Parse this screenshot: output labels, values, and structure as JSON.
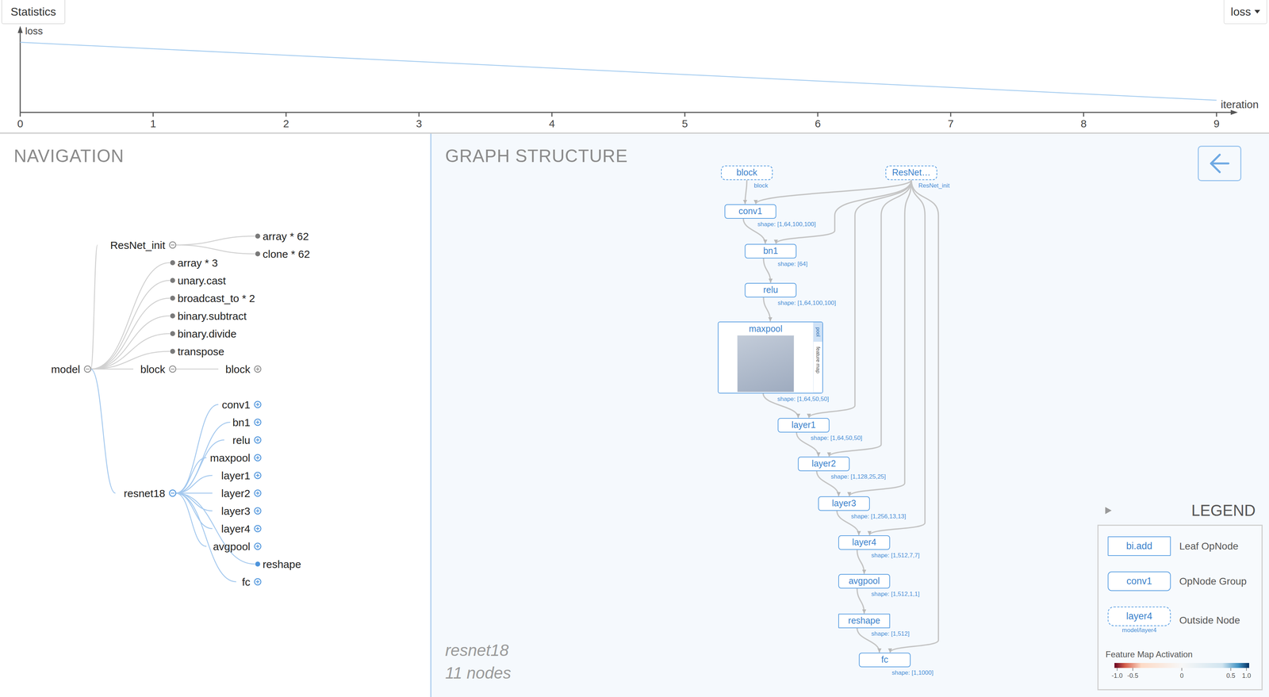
{
  "statistics": {
    "tab": "Statistics",
    "metric": "loss",
    "chart": {
      "y_label": "loss",
      "x_label": "iteration",
      "x_ticks": [
        "0",
        "1",
        "2",
        "3",
        "4",
        "5",
        "6",
        "7",
        "8",
        "9"
      ],
      "series": [
        {
          "values": [
            0.81,
            0.736,
            0.661,
            0.587,
            0.512,
            0.438,
            0.363,
            0.289,
            0.214,
            0.14
          ]
        }
      ]
    }
  },
  "navigation": {
    "title": "NAVIGATION",
    "tree": {
      "label": "model",
      "kind": "group",
      "expanded": true,
      "active": false,
      "children": [
        {
          "label": "ResNet_init",
          "kind": "group",
          "expanded": true,
          "active": false,
          "children": [
            {
              "label": "array * 62",
              "kind": "leaf",
              "active": false
            },
            {
              "label": "clone * 62",
              "kind": "leaf",
              "active": false
            }
          ]
        },
        {
          "label": "array * 3",
          "kind": "leaf",
          "active": false
        },
        {
          "label": "unary.cast",
          "kind": "leaf",
          "active": false
        },
        {
          "label": "broadcast_to * 2",
          "kind": "leaf",
          "active": false
        },
        {
          "label": "binary.subtract",
          "kind": "leaf",
          "active": false
        },
        {
          "label": "binary.divide",
          "kind": "leaf",
          "active": false
        },
        {
          "label": "transpose",
          "kind": "leaf",
          "active": false
        },
        {
          "label": "block",
          "kind": "group",
          "expanded": true,
          "active": false,
          "children": [
            {
              "label": "block",
              "kind": "group",
              "expanded": false,
              "active": false
            }
          ]
        },
        {
          "label": "resnet18",
          "kind": "group",
          "expanded": true,
          "active": true,
          "children": [
            {
              "label": "conv1",
              "kind": "group",
              "expanded": false,
              "active": true
            },
            {
              "label": "bn1",
              "kind": "group",
              "expanded": false,
              "active": true
            },
            {
              "label": "relu",
              "kind": "group",
              "expanded": false,
              "active": true
            },
            {
              "label": "maxpool",
              "kind": "group",
              "expanded": false,
              "active": true
            },
            {
              "label": "layer1",
              "kind": "group",
              "expanded": false,
              "active": true
            },
            {
              "label": "layer2",
              "kind": "group",
              "expanded": false,
              "active": true
            },
            {
              "label": "layer3",
              "kind": "group",
              "expanded": false,
              "active": true
            },
            {
              "label": "layer4",
              "kind": "group",
              "expanded": false,
              "active": true
            },
            {
              "label": "avgpool",
              "kind": "group",
              "expanded": false,
              "active": true
            },
            {
              "label": "reshape",
              "kind": "leaf",
              "active": true
            },
            {
              "label": "fc",
              "kind": "group",
              "expanded": false,
              "active": true
            }
          ]
        }
      ]
    }
  },
  "graph": {
    "title": "GRAPH STRUCTURE",
    "caption": "resnet18",
    "count": "11 nodes",
    "nodes": [
      {
        "label": "block",
        "kind": "outside",
        "sublabel": "block"
      },
      {
        "label": "ResNet…",
        "kind": "outside",
        "sublabel": "ResNet_init"
      },
      {
        "label": "conv1",
        "kind": "group",
        "shape": "shape: [1,64,100,100]"
      },
      {
        "label": "bn1",
        "kind": "group",
        "shape": "shape: [64]"
      },
      {
        "label": "relu",
        "kind": "group",
        "shape": "shape: [1,64,100,100]"
      },
      {
        "label": "maxpool",
        "kind": "feature",
        "shape": "shape: [1,64,50,50]",
        "tabs": [
          {
            "label": "pool",
            "selected": true
          },
          {
            "label": "feature map",
            "selected": false
          }
        ]
      },
      {
        "label": "layer1",
        "kind": "group",
        "shape": "shape: [1,64,50,50]"
      },
      {
        "label": "layer2",
        "kind": "group",
        "shape": "shape: [1,128,25,25]"
      },
      {
        "label": "layer3",
        "kind": "group",
        "shape": "shape: [1,256,13,13]"
      },
      {
        "label": "layer4",
        "kind": "group",
        "shape": "shape: [1,512,7,7]"
      },
      {
        "label": "avgpool",
        "kind": "group",
        "shape": "shape: [1,512,1,1]"
      },
      {
        "label": "reshape",
        "kind": "leaf",
        "shape": "shape: [1,512]"
      },
      {
        "label": "fc",
        "kind": "group",
        "shape": "shape: [1,1000]"
      }
    ],
    "edges": [
      {
        "from": "block",
        "to": "conv1"
      },
      {
        "from": "ResNet…",
        "to": "conv1"
      },
      {
        "from": "conv1",
        "to": "bn1"
      },
      {
        "from": "ResNet…",
        "to": "bn1"
      },
      {
        "from": "bn1",
        "to": "relu"
      },
      {
        "from": "relu",
        "to": "maxpool"
      },
      {
        "from": "maxpool",
        "to": "layer1"
      },
      {
        "from": "ResNet…",
        "to": "layer1"
      },
      {
        "from": "layer1",
        "to": "layer2"
      },
      {
        "from": "ResNet…",
        "to": "layer2"
      },
      {
        "from": "layer2",
        "to": "layer3"
      },
      {
        "from": "ResNet…",
        "to": "layer3"
      },
      {
        "from": "layer3",
        "to": "layer4"
      },
      {
        "from": "ResNet…",
        "to": "layer4"
      },
      {
        "from": "layer4",
        "to": "avgpool"
      },
      {
        "from": "avgpool",
        "to": "reshape"
      },
      {
        "from": "reshape",
        "to": "fc"
      },
      {
        "from": "ResNet…",
        "to": "fc"
      }
    ]
  },
  "legend": {
    "title": "LEGEND",
    "items": [
      {
        "kind": "leaf",
        "sample": "bi.add",
        "label": "Leaf OpNode"
      },
      {
        "kind": "group",
        "sample": "conv1",
        "label": "OpNode Group"
      },
      {
        "kind": "outside",
        "sample": "layer4",
        "sublabel": "model/layer4",
        "label": "Outside Node"
      }
    ],
    "activation": {
      "label": "Feature Map Activation",
      "ticks": [
        "-1.0",
        "-0.5",
        "0",
        "0.5",
        "1.0"
      ]
    }
  }
}
